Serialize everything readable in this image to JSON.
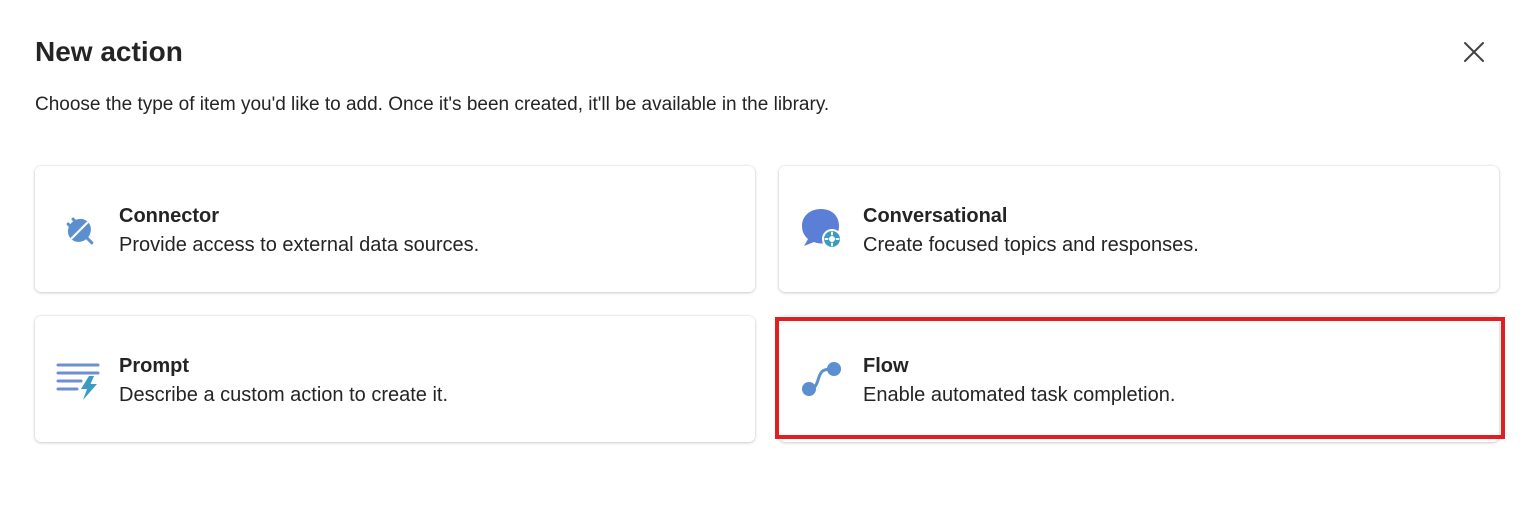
{
  "dialog": {
    "title": "New action",
    "subtitle": "Choose the type of item you'd like to add. Once it's been created, it'll be available in the library.",
    "close_icon": "close-icon"
  },
  "cards": [
    {
      "title": "Connector",
      "description": "Provide access to external data sources.",
      "icon": "plug-icon"
    },
    {
      "title": "Conversational",
      "description": "Create focused topics and responses.",
      "icon": "chat-gear-icon"
    },
    {
      "title": "Prompt",
      "description": "Describe a custom action to create it.",
      "icon": "text-lightning-icon"
    },
    {
      "title": "Flow",
      "description": "Enable automated task completion.",
      "icon": "flow-icon"
    }
  ],
  "colors": {
    "highlight": "#e02020",
    "icon_blue": "#5b8fd0",
    "icon_teal": "#3a9cc0",
    "text": "#242424"
  }
}
